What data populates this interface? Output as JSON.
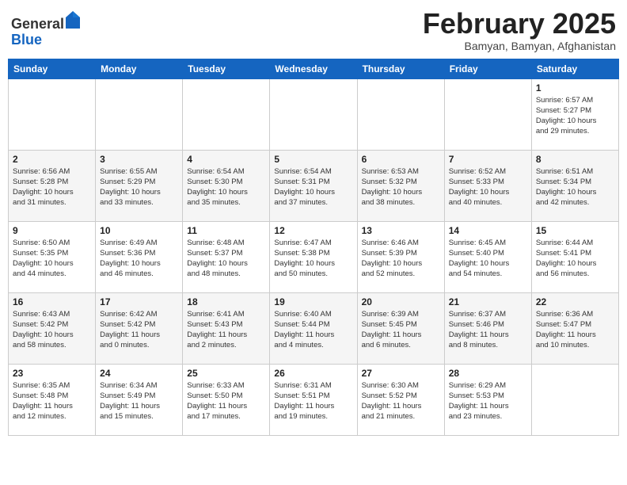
{
  "header": {
    "logo_general": "General",
    "logo_blue": "Blue",
    "month_title": "February 2025",
    "subtitle": "Bamyan, Bamyan, Afghanistan"
  },
  "weekdays": [
    "Sunday",
    "Monday",
    "Tuesday",
    "Wednesday",
    "Thursday",
    "Friday",
    "Saturday"
  ],
  "weeks": [
    [
      {
        "day": "",
        "info": ""
      },
      {
        "day": "",
        "info": ""
      },
      {
        "day": "",
        "info": ""
      },
      {
        "day": "",
        "info": ""
      },
      {
        "day": "",
        "info": ""
      },
      {
        "day": "",
        "info": ""
      },
      {
        "day": "1",
        "info": "Sunrise: 6:57 AM\nSunset: 5:27 PM\nDaylight: 10 hours\nand 29 minutes."
      }
    ],
    [
      {
        "day": "2",
        "info": "Sunrise: 6:56 AM\nSunset: 5:28 PM\nDaylight: 10 hours\nand 31 minutes."
      },
      {
        "day": "3",
        "info": "Sunrise: 6:55 AM\nSunset: 5:29 PM\nDaylight: 10 hours\nand 33 minutes."
      },
      {
        "day": "4",
        "info": "Sunrise: 6:54 AM\nSunset: 5:30 PM\nDaylight: 10 hours\nand 35 minutes."
      },
      {
        "day": "5",
        "info": "Sunrise: 6:54 AM\nSunset: 5:31 PM\nDaylight: 10 hours\nand 37 minutes."
      },
      {
        "day": "6",
        "info": "Sunrise: 6:53 AM\nSunset: 5:32 PM\nDaylight: 10 hours\nand 38 minutes."
      },
      {
        "day": "7",
        "info": "Sunrise: 6:52 AM\nSunset: 5:33 PM\nDaylight: 10 hours\nand 40 minutes."
      },
      {
        "day": "8",
        "info": "Sunrise: 6:51 AM\nSunset: 5:34 PM\nDaylight: 10 hours\nand 42 minutes."
      }
    ],
    [
      {
        "day": "9",
        "info": "Sunrise: 6:50 AM\nSunset: 5:35 PM\nDaylight: 10 hours\nand 44 minutes."
      },
      {
        "day": "10",
        "info": "Sunrise: 6:49 AM\nSunset: 5:36 PM\nDaylight: 10 hours\nand 46 minutes."
      },
      {
        "day": "11",
        "info": "Sunrise: 6:48 AM\nSunset: 5:37 PM\nDaylight: 10 hours\nand 48 minutes."
      },
      {
        "day": "12",
        "info": "Sunrise: 6:47 AM\nSunset: 5:38 PM\nDaylight: 10 hours\nand 50 minutes."
      },
      {
        "day": "13",
        "info": "Sunrise: 6:46 AM\nSunset: 5:39 PM\nDaylight: 10 hours\nand 52 minutes."
      },
      {
        "day": "14",
        "info": "Sunrise: 6:45 AM\nSunset: 5:40 PM\nDaylight: 10 hours\nand 54 minutes."
      },
      {
        "day": "15",
        "info": "Sunrise: 6:44 AM\nSunset: 5:41 PM\nDaylight: 10 hours\nand 56 minutes."
      }
    ],
    [
      {
        "day": "16",
        "info": "Sunrise: 6:43 AM\nSunset: 5:42 PM\nDaylight: 10 hours\nand 58 minutes."
      },
      {
        "day": "17",
        "info": "Sunrise: 6:42 AM\nSunset: 5:42 PM\nDaylight: 11 hours\nand 0 minutes."
      },
      {
        "day": "18",
        "info": "Sunrise: 6:41 AM\nSunset: 5:43 PM\nDaylight: 11 hours\nand 2 minutes."
      },
      {
        "day": "19",
        "info": "Sunrise: 6:40 AM\nSunset: 5:44 PM\nDaylight: 11 hours\nand 4 minutes."
      },
      {
        "day": "20",
        "info": "Sunrise: 6:39 AM\nSunset: 5:45 PM\nDaylight: 11 hours\nand 6 minutes."
      },
      {
        "day": "21",
        "info": "Sunrise: 6:37 AM\nSunset: 5:46 PM\nDaylight: 11 hours\nand 8 minutes."
      },
      {
        "day": "22",
        "info": "Sunrise: 6:36 AM\nSunset: 5:47 PM\nDaylight: 11 hours\nand 10 minutes."
      }
    ],
    [
      {
        "day": "23",
        "info": "Sunrise: 6:35 AM\nSunset: 5:48 PM\nDaylight: 11 hours\nand 12 minutes."
      },
      {
        "day": "24",
        "info": "Sunrise: 6:34 AM\nSunset: 5:49 PM\nDaylight: 11 hours\nand 15 minutes."
      },
      {
        "day": "25",
        "info": "Sunrise: 6:33 AM\nSunset: 5:50 PM\nDaylight: 11 hours\nand 17 minutes."
      },
      {
        "day": "26",
        "info": "Sunrise: 6:31 AM\nSunset: 5:51 PM\nDaylight: 11 hours\nand 19 minutes."
      },
      {
        "day": "27",
        "info": "Sunrise: 6:30 AM\nSunset: 5:52 PM\nDaylight: 11 hours\nand 21 minutes."
      },
      {
        "day": "28",
        "info": "Sunrise: 6:29 AM\nSunset: 5:53 PM\nDaylight: 11 hours\nand 23 minutes."
      },
      {
        "day": "",
        "info": ""
      }
    ]
  ]
}
